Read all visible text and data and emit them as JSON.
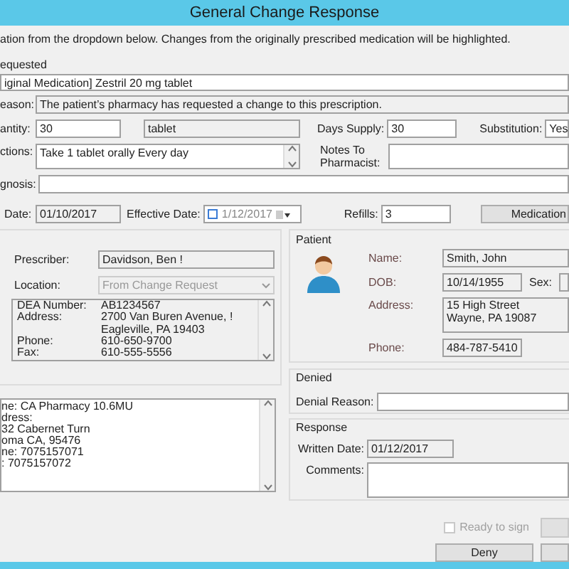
{
  "window": {
    "title": "General Change Response"
  },
  "instruction": "ation from the dropdown below. Changes from the originally prescribed medication will be highlighted.",
  "requested": {
    "group_label": "equested",
    "medication": "iginal Medication] Zestril 20 mg tablet",
    "reason_label": "eason:",
    "reason": "The patient’s pharmacy has requested a change to this prescription."
  },
  "quantity": {
    "label": "antity:",
    "value": "30",
    "unit": "tablet"
  },
  "days_supply": {
    "label": "Days Supply:",
    "value": "30"
  },
  "substitution": {
    "label": "Substitution:",
    "value": "Yes"
  },
  "directions": {
    "label": "ctions:",
    "value": "Take 1 tablet orally Every day"
  },
  "notes": {
    "label": "Notes To Pharmacist:"
  },
  "diagnosis": {
    "label": "gnosis:"
  },
  "written_date": {
    "label": "Date:",
    "value": "01/10/2017"
  },
  "effective_date": {
    "label": "Effective Date:",
    "value": "1/12/2017",
    "checked": false
  },
  "refills": {
    "label": "Refills:",
    "value": "3"
  },
  "medication_button": "Medication",
  "prescriber": {
    "label": "Prescriber:",
    "value": "Davidson, Ben !",
    "location_label": "Location:",
    "location": "From Change Request",
    "details": [
      {
        "label": "DEA Number:",
        "value": "AB1234567"
      },
      {
        "label": "Address:",
        "value": "2700 Van Buren Avenue, !"
      },
      {
        "value": "Eagleville, PA 19403"
      },
      {
        "label": "Phone:",
        "value": "610-650-9700"
      },
      {
        "label": "Fax:",
        "value": "610-555-5556"
      }
    ]
  },
  "pharmacy": {
    "lines": [
      "ne: CA Pharmacy 10.6MU",
      "dress:",
      "32 Cabernet Turn",
      "oma CA, 95476",
      "ne: 7075157071",
      ": 7075157072"
    ]
  },
  "patient": {
    "group_label": "Patient",
    "name_label": "Name:",
    "name": "Smith, John",
    "dob_label": "DOB:",
    "dob": "10/14/1955",
    "sex_label": "Sex:",
    "address_label": "Address:",
    "address": [
      "15 High Street",
      "Wayne, PA 19087"
    ],
    "phone_label": "Phone:",
    "phone": "484-787-5410"
  },
  "denied": {
    "group_label": "Denied",
    "reason_label": "Denial Reason:"
  },
  "response": {
    "group_label": "Response",
    "written_date_label": "Written Date:",
    "written_date": "01/12/2017",
    "comments_label": "Comments:"
  },
  "ready_to_sign": {
    "label": "Ready to sign",
    "checked": false,
    "disabled": true
  },
  "deny_button": "Deny"
}
